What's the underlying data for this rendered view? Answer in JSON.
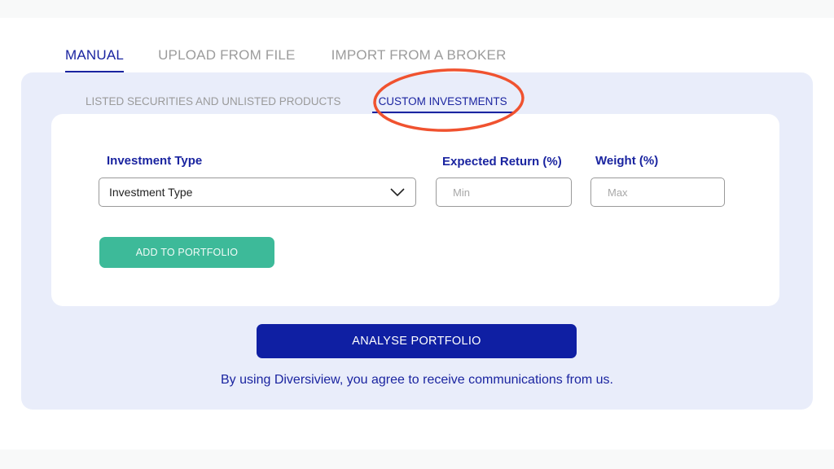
{
  "main_tabs": [
    {
      "label": "MANUAL",
      "active": true
    },
    {
      "label": "UPLOAD FROM FILE",
      "active": false
    },
    {
      "label": "IMPORT FROM A BROKER",
      "active": false
    }
  ],
  "sub_tabs": [
    {
      "label": "LISTED SECURITIES AND UNLISTED PRODUCTS",
      "active": false
    },
    {
      "label": "CUSTOM INVESTMENTS",
      "active": true
    }
  ],
  "form": {
    "investment_type": {
      "label": "Investment Type",
      "selected": "Investment Type"
    },
    "expected_return": {
      "label": "Expected Return (%)",
      "value": "",
      "placeholder": "Min"
    },
    "weight": {
      "label": "Weight (%)",
      "value": "",
      "placeholder": "Max"
    },
    "add_button": "ADD TO PORTFOLIO"
  },
  "analyse_button": "ANALYSE PORTFOLIO",
  "consent_text": "By using Diversiview, you agree to receive communications from us.",
  "colors": {
    "brand_blue": "#1a24a0",
    "primary_button": "#0f1fa3",
    "add_button": "#3dba99",
    "panel_bg": "#e9edfa",
    "annotation": "#f0522f"
  },
  "annotation": {
    "target": "custom-investments-tab",
    "shape": "ellipse",
    "color": "#f0522f"
  }
}
